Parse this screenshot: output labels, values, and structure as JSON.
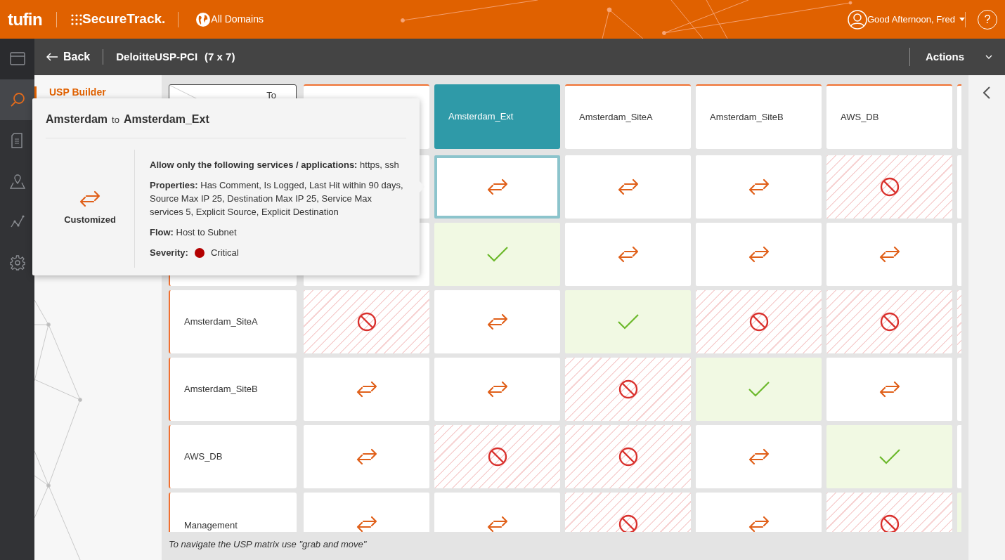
{
  "header": {
    "logo": "tufin",
    "product": "SecureTrack.",
    "domain": "All Domains",
    "greeting": "Good Afternoon, Fred",
    "help": "?"
  },
  "nav": [
    {
      "selected": false
    },
    {
      "selected": true
    },
    {
      "selected": false
    },
    {
      "selected": false
    },
    {
      "selected": false
    },
    {
      "selected": false
    }
  ],
  "toolbar": {
    "back": "Back",
    "title": "DeloitteUSP-PCI",
    "size": "(7 x 7)",
    "actions": "Actions"
  },
  "side_panel": {
    "title": "USP Builder"
  },
  "matrix": {
    "corner": "To",
    "columns": [
      {
        "kind": "covered",
        "selected": false
      },
      {
        "kind": "zone",
        "label": "Amsterdam_Ext",
        "selected": true
      },
      {
        "kind": "zone",
        "label": "Amsterdam_SiteA",
        "selected": false
      },
      {
        "kind": "zone",
        "label": "Amsterdam_SiteB",
        "selected": false
      },
      {
        "kind": "zone",
        "label": "AWS_DB",
        "selected": false
      },
      {
        "kind": "partial",
        "selected": false
      }
    ],
    "rows": [
      {
        "kind": "covered",
        "cells": [
          {
            "kind": "covered",
            "selected": false
          },
          {
            "kind": "customized",
            "selected": true
          },
          {
            "kind": "customized",
            "selected": false
          },
          {
            "kind": "customized",
            "selected": false
          },
          {
            "kind": "blocked",
            "selected": false
          },
          {
            "kind": "customized",
            "selected": false
          }
        ]
      },
      {
        "kind": "covered",
        "cells": [
          {
            "kind": "covered",
            "selected": false
          },
          {
            "kind": "allowed",
            "selected": false
          },
          {
            "kind": "customized",
            "selected": false
          },
          {
            "kind": "customized",
            "selected": false
          },
          {
            "kind": "customized",
            "selected": false
          },
          {
            "kind": "customized",
            "selected": false
          }
        ]
      },
      {
        "kind": "zone",
        "label": "Amsterdam_SiteA",
        "cells": [
          {
            "kind": "blocked",
            "selected": false
          },
          {
            "kind": "customized",
            "selected": false
          },
          {
            "kind": "allowed",
            "selected": false
          },
          {
            "kind": "blocked",
            "selected": false
          },
          {
            "kind": "blocked",
            "selected": false
          },
          {
            "kind": "blocked",
            "selected": false
          }
        ]
      },
      {
        "kind": "zone",
        "label": "Amsterdam_SiteB",
        "cells": [
          {
            "kind": "customized",
            "selected": false
          },
          {
            "kind": "customized",
            "selected": false
          },
          {
            "kind": "blocked",
            "selected": false
          },
          {
            "kind": "allowed",
            "selected": false
          },
          {
            "kind": "customized",
            "selected": false
          },
          {
            "kind": "customized",
            "selected": false
          }
        ]
      },
      {
        "kind": "zone",
        "label": "AWS_DB",
        "cells": [
          {
            "kind": "customized",
            "selected": false
          },
          {
            "kind": "blocked",
            "selected": false
          },
          {
            "kind": "blocked",
            "selected": false
          },
          {
            "kind": "customized",
            "selected": false
          },
          {
            "kind": "allowed",
            "selected": false
          },
          {
            "kind": "customized",
            "selected": false
          }
        ]
      },
      {
        "kind": "zone",
        "label": "Management",
        "cells": [
          {
            "kind": "customized",
            "selected": false
          },
          {
            "kind": "customized",
            "selected": false
          },
          {
            "kind": "blocked",
            "selected": false
          },
          {
            "kind": "customized",
            "selected": false
          },
          {
            "kind": "blocked",
            "selected": false
          },
          {
            "kind": "allowed",
            "selected": false
          }
        ]
      }
    ],
    "hint": "To navigate the USP matrix use \"grab and move\""
  },
  "tooltip": {
    "source": "Amsterdam",
    "connector": "to",
    "destination": "Amsterdam_Ext",
    "kind": "customized",
    "status": "Customized",
    "details": [
      {
        "label": "Allow only the following services / applications:",
        "value": "https, ssh"
      },
      {
        "label": "Properties:",
        "value": "Has Comment, Is Logged, Last Hit within 90 days, Source Max IP 25, Destination Max IP 25, Service Max services 5, Explicit Source, Explicit Destination"
      },
      {
        "label": "Flow:",
        "value": "Host to Subnet"
      },
      {
        "label": "Severity:",
        "value": "Critical",
        "color": "#b30000"
      }
    ]
  }
}
